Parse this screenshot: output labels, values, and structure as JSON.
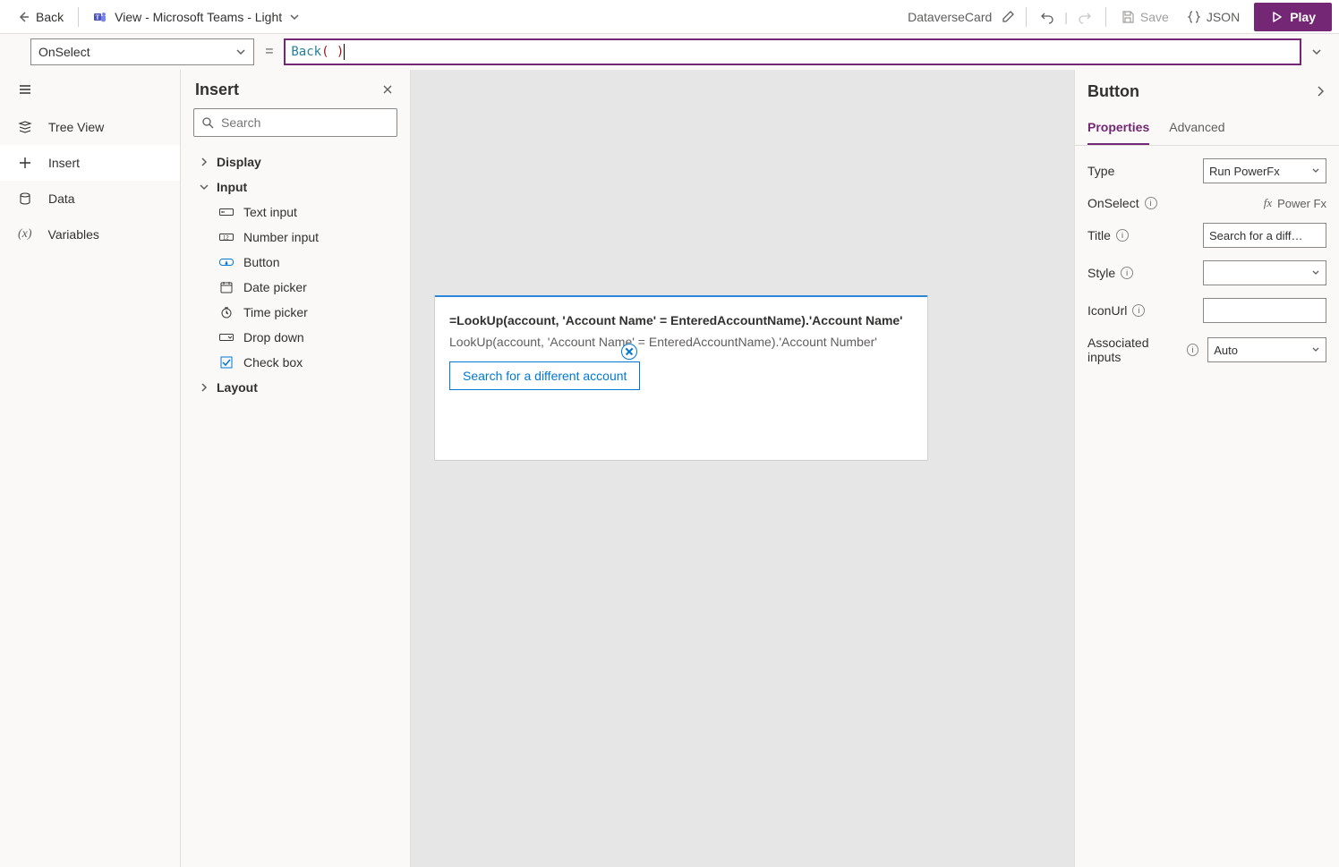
{
  "topbar": {
    "back_label": "Back",
    "theme_label": "View - Microsoft Teams - Light",
    "doc_name": "DataverseCard",
    "save_label": "Save",
    "json_label": "JSON",
    "play_label": "Play"
  },
  "formula": {
    "property": "OnSelect",
    "fn": "Back",
    "paren": "( )"
  },
  "rail": {
    "tree_view": "Tree View",
    "insert": "Insert",
    "data": "Data",
    "variables": "Variables"
  },
  "insert": {
    "title": "Insert",
    "search_placeholder": "Search",
    "cat_display": "Display",
    "cat_input": "Input",
    "cat_layout": "Layout",
    "items": {
      "text_input": "Text input",
      "number_input": "Number input",
      "button": "Button",
      "date_picker": "Date picker",
      "time_picker": "Time picker",
      "drop_down": "Drop down",
      "check_box": "Check box"
    }
  },
  "card": {
    "title": "=LookUp(account, 'Account Name' = EnteredAccountName).'Account Name'",
    "sub": "LookUp(account, 'Account Name' = EnteredAccountName).'Account Number'",
    "button_label": "Search for a different account"
  },
  "props": {
    "header": "Button",
    "tab_properties": "Properties",
    "tab_advanced": "Advanced",
    "type_label": "Type",
    "type_value": "Run PowerFx",
    "onselect_label": "OnSelect",
    "onselect_value": "Power Fx",
    "title_label": "Title",
    "title_value": "Search for a differe...",
    "style_label": "Style",
    "style_value": "",
    "iconurl_label": "IconUrl",
    "iconurl_value": "",
    "assoc_label": "Associated inputs",
    "assoc_value": "Auto"
  }
}
